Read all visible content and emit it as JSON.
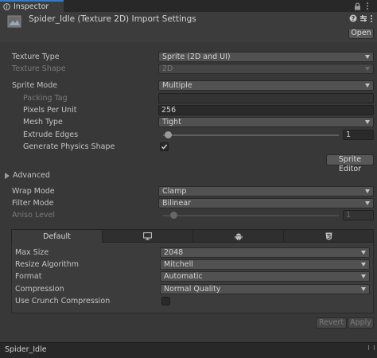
{
  "window": {
    "tab_label": "Inspector",
    "title": "Spider_Idle (Texture 2D) Import Settings",
    "open_label": "Open"
  },
  "texture": {
    "type_label": "Texture Type",
    "type_value": "Sprite (2D and UI)",
    "shape_label": "Texture Shape",
    "shape_value": "2D",
    "sprite_mode_label": "Sprite Mode",
    "sprite_mode_value": "Multiple",
    "packing_tag_label": "Packing Tag",
    "packing_tag_value": "",
    "ppu_label": "Pixels Per Unit",
    "ppu_value": "256",
    "mesh_type_label": "Mesh Type",
    "mesh_type_value": "Tight",
    "extrude_label": "Extrude Edges",
    "extrude_value": "1",
    "extrude_fraction": 0.03,
    "physics_label": "Generate Physics Shape",
    "physics_checked": true,
    "sprite_editor_label": "Sprite Editor"
  },
  "advanced": {
    "label": "Advanced",
    "expanded": false
  },
  "sampling": {
    "wrap_label": "Wrap Mode",
    "wrap_value": "Clamp",
    "filter_label": "Filter Mode",
    "filter_value": "Bilinear",
    "aniso_label": "Aniso Level",
    "aniso_value": "1",
    "aniso_fraction": 0.06
  },
  "platform": {
    "tabs": [
      {
        "label": "Default",
        "icon": null,
        "active": true
      },
      {
        "label": "",
        "icon": "monitor-icon",
        "active": false
      },
      {
        "label": "",
        "icon": "android-icon",
        "active": false
      },
      {
        "label": "",
        "icon": "html5-icon",
        "active": false
      }
    ],
    "max_size_label": "Max Size",
    "max_size_value": "2048",
    "resize_label": "Resize Algorithm",
    "resize_value": "Mitchell",
    "format_label": "Format",
    "format_value": "Automatic",
    "compression_label": "Compression",
    "compression_value": "Normal Quality",
    "crunch_label": "Use Crunch Compression",
    "crunch_checked": false
  },
  "actions": {
    "revert_label": "Revert",
    "apply_label": "Apply"
  },
  "footer": {
    "asset_name": "Spider_Idle"
  },
  "colors": {
    "background": "#383838",
    "accent": "#3a79bb"
  }
}
